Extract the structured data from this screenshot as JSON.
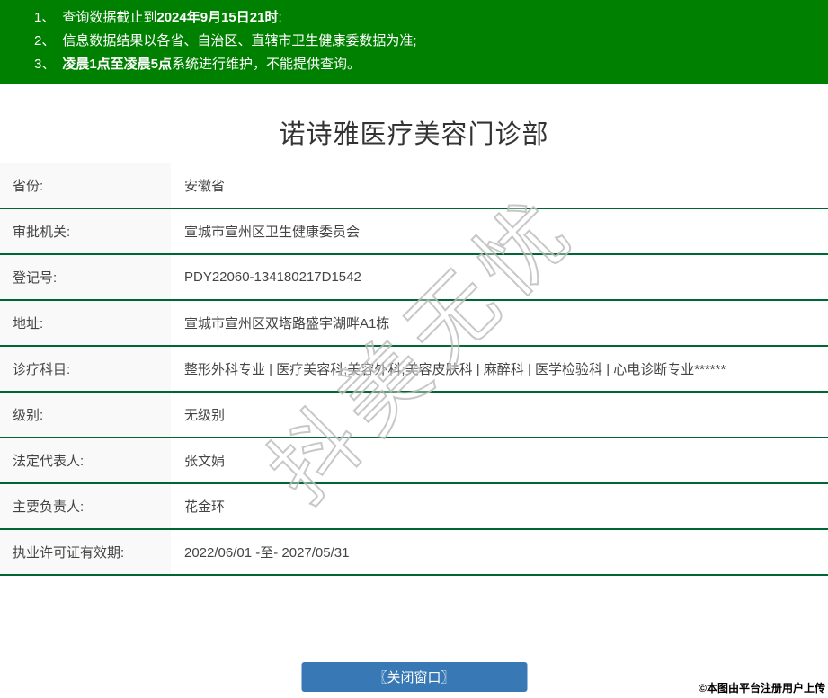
{
  "colors": {
    "banner_green": "#008000",
    "row_border_green": "#006633",
    "label_bg": "#f9f9f9",
    "button_blue": "#3879b5",
    "text_dark": "#444444"
  },
  "notices": {
    "items": [
      {
        "num": "1、",
        "pre": "查询数据截止到",
        "bold": "2024年9月15日21时",
        "post": ";"
      },
      {
        "num": "2、",
        "pre": "信息数据结果以各省、自治区、直辖市卫生健康委数据为准;",
        "bold": "",
        "post": ""
      },
      {
        "num": "3、",
        "pre": "",
        "bold": "凌晨1点至凌晨5点",
        "post": "系统进行维护，不能提供查询。"
      }
    ]
  },
  "title": "诺诗雅医疗美容门诊部",
  "table": {
    "rows": [
      {
        "label": "省份:",
        "value": "安徽省"
      },
      {
        "label": "审批机关:",
        "value": "宣城市宣州区卫生健康委员会"
      },
      {
        "label": "登记号:",
        "value": "PDY22060-134180217D1542"
      },
      {
        "label": "地址:",
        "value": "宣城市宣州区双塔路盛宇湖畔A1栋"
      },
      {
        "label": "诊疗科目:",
        "value": "整形外科专业 | 医疗美容科;美容外科;美容皮肤科 | 麻醉科 | 医学检验科 | 心电诊断专业******"
      },
      {
        "label": "级别:",
        "value": "无级别"
      },
      {
        "label": "法定代表人:",
        "value": "张文娟"
      },
      {
        "label": "主要负责人:",
        "value": "花金环"
      },
      {
        "label": "执业许可证有效期:",
        "value": "2022/06/01 -至- 2027/05/31"
      }
    ]
  },
  "watermark": "抖美无忧",
  "close_button_label": "〖关闭窗口〗",
  "footer_note": "©本图由平台注册用户上传"
}
